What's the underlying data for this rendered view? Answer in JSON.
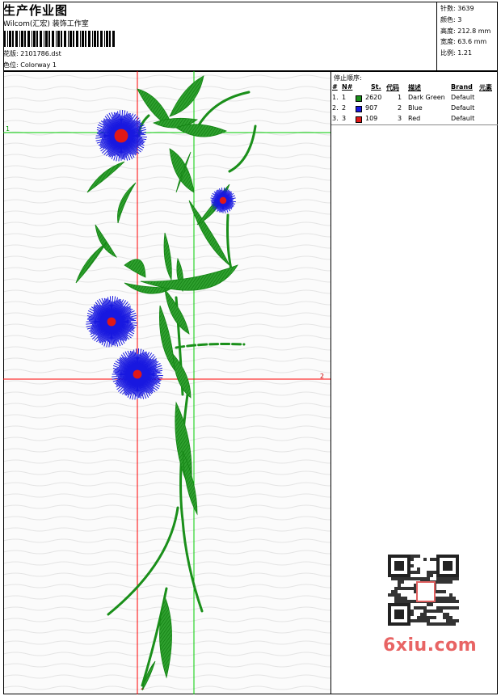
{
  "header": {
    "title": "生产作业图",
    "company": "Wilcom(汇宏) 装饰工作室",
    "design_label": "花版: 2101786.dst",
    "colorway_label": "色位: Colorway 1"
  },
  "stats": [
    {
      "label": "针数",
      "value": "3639"
    },
    {
      "label": "颜色",
      "value": "3"
    },
    {
      "label": "高度",
      "value": "212.8 mm"
    },
    {
      "label": "宽度",
      "value": "63.6 mm"
    },
    {
      "label": "比例",
      "value": "1.21"
    }
  ],
  "stop_sequence": {
    "title": "停止顺序:",
    "columns": [
      "#",
      "N#",
      "St.",
      "代码",
      "描述",
      "Brand",
      "元素"
    ],
    "rows": [
      {
        "idx": "1.",
        "n": "1",
        "color": "#1a8f1a",
        "stitches": "2620",
        "code": "1",
        "desc": "Dark Green",
        "brand": "Default"
      },
      {
        "idx": "2.",
        "n": "2",
        "color": "#1818e0",
        "stitches": "907",
        "code": "2",
        "desc": "Blue",
        "brand": "Default"
      },
      {
        "idx": "3.",
        "n": "3",
        "color": "#e01818",
        "stitches": "109",
        "code": "3",
        "desc": "Red",
        "brand": "Default"
      }
    ]
  },
  "guides": {
    "h1": "1",
    "h2": "2",
    "v2": "2"
  },
  "watermark": "6xiu.com",
  "colors": {
    "green": "#1a8f1a",
    "blue": "#1818e0",
    "red": "#e01818",
    "guide_red": "#ff0000",
    "guide_green": "#00cc00"
  }
}
